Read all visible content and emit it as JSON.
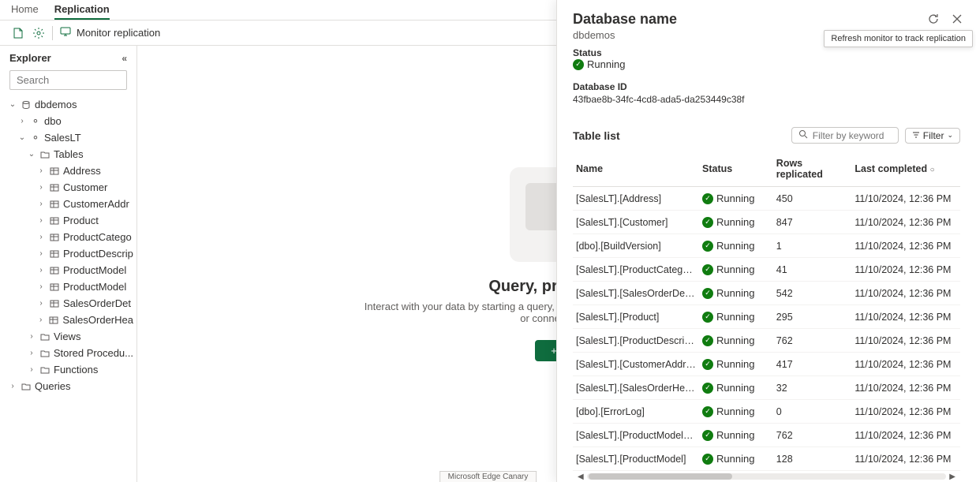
{
  "tabs": {
    "home": "Home",
    "replication": "Replication"
  },
  "toolbar": {
    "monitor": "Monitor replication"
  },
  "explorer": {
    "title": "Explorer",
    "search_placeholder": "Search",
    "db": "dbdemos",
    "schema_dbo": "dbo",
    "schema_saleslt": "SalesLT",
    "folder_tables": "Tables",
    "tables": [
      "Address",
      "Customer",
      "CustomerAddr",
      "Product",
      "ProductCatego",
      "ProductDescrip",
      "ProductModel",
      "ProductModel",
      "SalesOrderDet",
      "SalesOrderHea"
    ],
    "folder_views": "Views",
    "folder_sp": "Stored Procedu...",
    "folder_functions": "Functions",
    "queries": "Queries"
  },
  "center": {
    "title": "Query, preview, or",
    "subtitle": "Interact with your data by starting a query, creating database objects with a template, or connecting th",
    "new_btn": "+ N"
  },
  "panel": {
    "heading": "Database name",
    "db_name": "dbdemos",
    "status_label": "Status",
    "status_value": "Running",
    "dbid_label": "Database ID",
    "dbid_value": "43fbae8b-34fc-4cd8-ada5-da253449c38f",
    "tooltip": "Refresh monitor to track replication",
    "table_list_label": "Table list",
    "filter_placeholder": "Filter by keyword",
    "filter_btn": "Filter",
    "columns": {
      "name": "Name",
      "status": "Status",
      "rows": "Rows replicated",
      "last": "Last completed"
    },
    "rows": [
      {
        "name": "[SalesLT].[Address]",
        "status": "Running",
        "rows": "450",
        "last": "11/10/2024, 12:36 PM"
      },
      {
        "name": "[SalesLT].[Customer]",
        "status": "Running",
        "rows": "847",
        "last": "11/10/2024, 12:36 PM"
      },
      {
        "name": "[dbo].[BuildVersion]",
        "status": "Running",
        "rows": "1",
        "last": "11/10/2024, 12:36 PM"
      },
      {
        "name": "[SalesLT].[ProductCategory]",
        "status": "Running",
        "rows": "41",
        "last": "11/10/2024, 12:36 PM"
      },
      {
        "name": "[SalesLT].[SalesOrderDetail]",
        "status": "Running",
        "rows": "542",
        "last": "11/10/2024, 12:36 PM"
      },
      {
        "name": "[SalesLT].[Product]",
        "status": "Running",
        "rows": "295",
        "last": "11/10/2024, 12:36 PM"
      },
      {
        "name": "[SalesLT].[ProductDescription]",
        "status": "Running",
        "rows": "762",
        "last": "11/10/2024, 12:36 PM"
      },
      {
        "name": "[SalesLT].[CustomerAddress]",
        "status": "Running",
        "rows": "417",
        "last": "11/10/2024, 12:36 PM"
      },
      {
        "name": "[SalesLT].[SalesOrderHeader]",
        "status": "Running",
        "rows": "32",
        "last": "11/10/2024, 12:36 PM"
      },
      {
        "name": "[dbo].[ErrorLog]",
        "status": "Running",
        "rows": "0",
        "last": "11/10/2024, 12:36 PM"
      },
      {
        "name": "[SalesLT].[ProductModelProdu...",
        "status": "Running",
        "rows": "762",
        "last": "11/10/2024, 12:36 PM"
      },
      {
        "name": "[SalesLT].[ProductModel]",
        "status": "Running",
        "rows": "128",
        "last": "11/10/2024, 12:36 PM"
      }
    ]
  },
  "edge_label": "Microsoft Edge Canary"
}
